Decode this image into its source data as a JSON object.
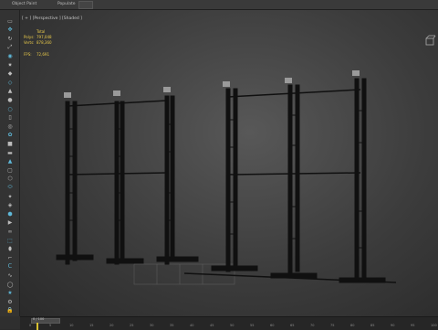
{
  "top_bar": {
    "tab_object_paint": "Object Paint",
    "tab_populate": "Populate"
  },
  "viewport": {
    "label": "[ + ] [Perspective ] [Shaded ]",
    "stats": {
      "header": "Total",
      "polys_label": "Polys:",
      "polys_value": "797,048",
      "verts_label": "Verts:",
      "verts_value": "878,360",
      "fps_label": "FPS:",
      "fps_value": "72,691"
    }
  },
  "timeline": {
    "frame_readout": "0 / 100",
    "ticks": [
      "0",
      "5",
      "10",
      "15",
      "20",
      "25",
      "30",
      "35",
      "40",
      "45",
      "50",
      "55",
      "60",
      "65",
      "70",
      "75",
      "80",
      "85",
      "90",
      "95",
      "100"
    ]
  },
  "colors": {
    "stats_text": "#e8c94a",
    "key_marker": "#d8c030",
    "frame_metal": "#101010"
  },
  "icons": [
    "select-icon",
    "move-icon",
    "rotate-icon",
    "scale-icon",
    "camera-icon",
    "light-icon",
    "helper-icon",
    "spacewarp-icon",
    "system-icon",
    "cone-icon",
    "sphere-icon",
    "cylinder-icon",
    "torus-icon",
    "teapot-icon",
    "box-icon",
    "plane-icon",
    "pyramid-icon",
    "tube-icon",
    "geosphere-icon",
    "capsule-icon",
    "hedra-icon",
    "spindle-icon",
    "gengon-icon",
    "prism-icon",
    "torusknot-icon",
    "chamfer-icon",
    "oiltank-icon",
    "lshape-icon",
    "cshape-icon",
    "hose-icon",
    "ring-icon",
    "star-icon",
    "settings-icon",
    "lock-icon"
  ]
}
